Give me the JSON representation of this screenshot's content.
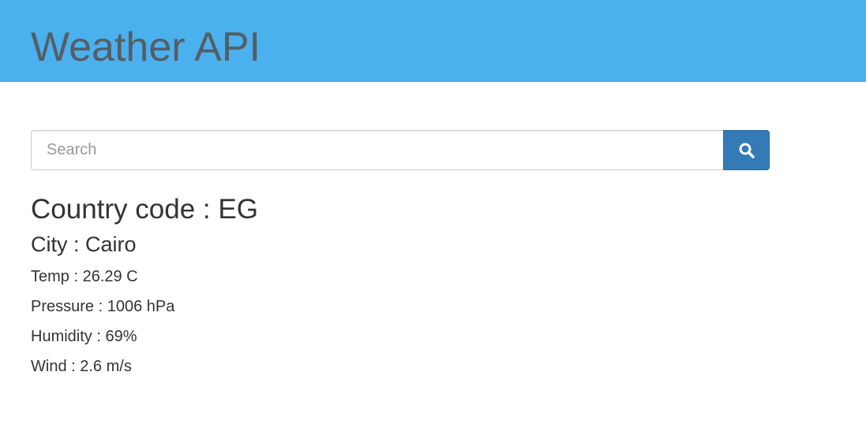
{
  "header": {
    "title": "Weather API",
    "background_color": "#4bb0ee"
  },
  "search": {
    "placeholder": "Search",
    "value": "",
    "button_icon": "search-icon",
    "button_color": "#337ab7"
  },
  "result": {
    "country": "Country code : EG",
    "city": "City : Cairo",
    "temp": "Temp : 26.29 C",
    "pressure": "Pressure : 1006 hPa",
    "humidity": "Humidity : 69%",
    "wind": "Wind : 2.6 m/s"
  }
}
